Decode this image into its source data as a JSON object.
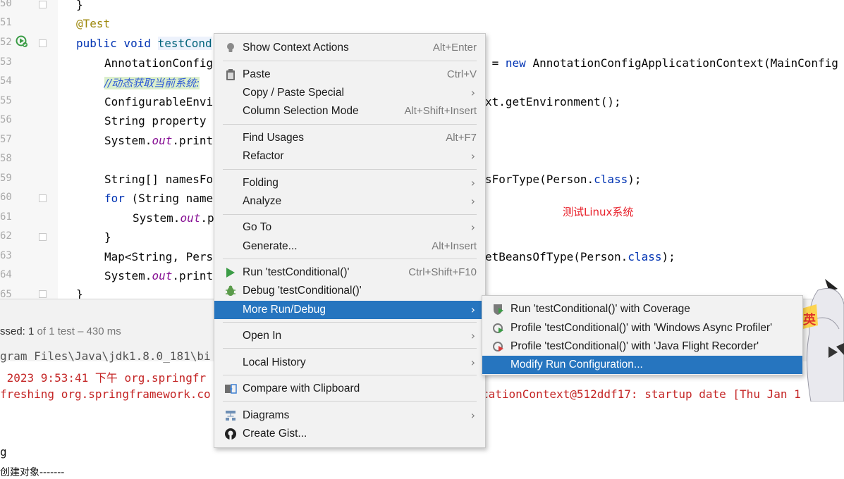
{
  "editor": {
    "line_numbers": [
      "50",
      "51",
      "52",
      "53",
      "54",
      "55",
      "56",
      "57",
      "58",
      "59",
      "60",
      "61",
      "62",
      "63",
      "64",
      "65"
    ],
    "lines": {
      "l50": "}",
      "l51_ann": "@Test",
      "l52_kw": "public void ",
      "l52_name": "testCond",
      "l53_a": "AnnotationConfig",
      "l53_b": " = ",
      "l53_kw": "new",
      "l53_c": " AnnotationConfigApplicationContext(MainConfig",
      "l54_cmt": "//动态获取当前系统:",
      "l55_a": "ConfigurableEnvi",
      "l55_b": "xt.getEnvironment();",
      "l56": "String property",
      "l57_a": "System.",
      "l57_fld": "out",
      "l57_b": ".print",
      "l59_a": "String[] namesFo",
      "l59_b": "sForType(Person.",
      "l59_kw": "class",
      "l59_c": ");",
      "l60_kw": "for",
      "l60_a": " (String name",
      "l61_a": "System.",
      "l61_fld": "out",
      "l61_b": ".p",
      "l62": "}",
      "l63_a": "Map<String, Pers",
      "l63_b": "etBeansOfType(Person.",
      "l63_kw": "class",
      "l63_c": ");",
      "l64_a": "System.",
      "l64_fld": "out",
      "l64_b": ".print",
      "l65": "}"
    },
    "note": "测试Linux系统"
  },
  "run_panel": {
    "tests_passed_label": "ssed:",
    "tests_passed_count": "1",
    "tests_total": "of 1 test – 430 ms",
    "console": [
      "gram Files\\Java\\jdk1.8.0_181\\bi",
      " 2023 9:53:41 下午 org.springfr",
      "freshing org.springframework.co",
      "cationContext@512ddf17: startup date [Thu Jan 1",
      "g",
      "创建对象-------"
    ]
  },
  "context_menu": {
    "items": [
      {
        "label": "Show Context Actions",
        "shortcut": "Alt+Enter"
      },
      {
        "label": "Paste",
        "shortcut": "Ctrl+V"
      },
      {
        "label": "Copy / Paste Special",
        "shortcut": ""
      },
      {
        "label": "Column Selection Mode",
        "shortcut": "Alt+Shift+Insert"
      },
      {
        "label": "Find Usages",
        "shortcut": "Alt+F7"
      },
      {
        "label": "Refactor",
        "shortcut": ""
      },
      {
        "label": "Folding",
        "shortcut": ""
      },
      {
        "label": "Analyze",
        "shortcut": ""
      },
      {
        "label": "Go To",
        "shortcut": ""
      },
      {
        "label": "Generate...",
        "shortcut": "Alt+Insert"
      },
      {
        "label": "Run 'testConditional()'",
        "shortcut": "Ctrl+Shift+F10"
      },
      {
        "label": "Debug 'testConditional()'",
        "shortcut": ""
      },
      {
        "label": "More Run/Debug",
        "shortcut": ""
      },
      {
        "label": "Open In",
        "shortcut": ""
      },
      {
        "label": "Local History",
        "shortcut": ""
      },
      {
        "label": "Compare with Clipboard",
        "shortcut": ""
      },
      {
        "label": "Diagrams",
        "shortcut": ""
      },
      {
        "label": "Create Gist...",
        "shortcut": ""
      }
    ],
    "selected": "More Run/Debug"
  },
  "submenu": {
    "items": [
      {
        "label": "Run 'testConditional()' with Coverage"
      },
      {
        "label": "Profile 'testConditional()' with 'Windows Async Profiler'"
      },
      {
        "label": "Profile 'testConditional()' with 'Java Flight Recorder'"
      },
      {
        "label": "Modify Run Configuration..."
      }
    ],
    "selected": "Modify Run Configuration..."
  },
  "icons": {
    "bulb": "lightbulb-icon",
    "paste": "clipboard-icon",
    "run": "run-play-icon",
    "debug": "debug-bug-icon",
    "compare": "compare-icon",
    "diagrams": "diagram-icon",
    "gist": "github-icon",
    "coverage": "coverage-icon",
    "profiler": "profiler-icon"
  },
  "colors": {
    "selection": "#2675bf",
    "menu_bg": "#f2f2f2",
    "run_green": "#3b9c46"
  }
}
